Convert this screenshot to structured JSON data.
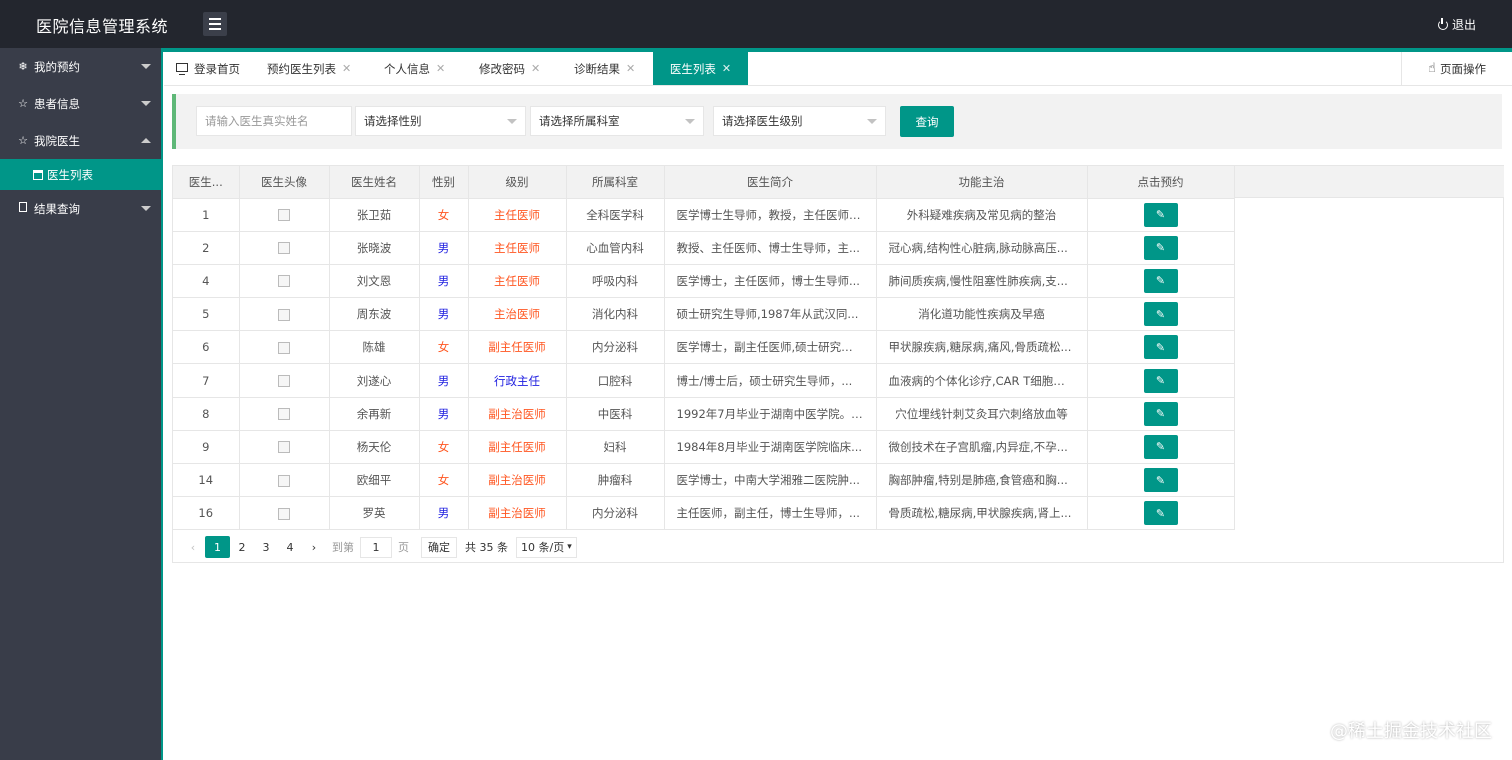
{
  "header": {
    "title": "医院信息管理系统",
    "logout_label": "退出"
  },
  "sidebar": {
    "items": [
      {
        "label": "我的预约",
        "icon": "snowflake-icon",
        "expanded": false
      },
      {
        "label": "患者信息",
        "icon": "star-icon",
        "expanded": false
      },
      {
        "label": "我院医生",
        "icon": "star-icon",
        "expanded": true
      },
      {
        "label": "结果查询",
        "icon": "document-icon",
        "expanded": false
      }
    ],
    "sub_item": {
      "label": "医生列表",
      "icon": "calendar-icon"
    }
  },
  "tabs": [
    {
      "label": "登录首页",
      "closable": false
    },
    {
      "label": "预约医生列表",
      "closable": true
    },
    {
      "label": "个人信息",
      "closable": true
    },
    {
      "label": "修改密码",
      "closable": true
    },
    {
      "label": "诊断结果",
      "closable": true
    },
    {
      "label": "医生列表",
      "closable": true,
      "active": true
    }
  ],
  "tab_close": "✕",
  "page_ops_label": "页面操作",
  "search": {
    "name_placeholder": "请输入医生真实姓名",
    "gender_select": "请选择性别",
    "dept_select": "请选择所属科室",
    "level_select": "请选择医生级别",
    "query_label": "查询"
  },
  "table": {
    "headers": [
      "医生...",
      "医生头像",
      "医生姓名",
      "性别",
      "级别",
      "所属科室",
      "医生简介",
      "功能主治",
      "点击预约"
    ],
    "rows": [
      {
        "id": "1",
        "name": "张卫茹",
        "gender": "女",
        "level": "主任医师",
        "dept": "全科医学科",
        "intro": "医学博士生导师，教授，主任医师,...",
        "specialty": "外科疑难疾病及常见病的整治"
      },
      {
        "id": "2",
        "name": "张晓波",
        "gender": "男",
        "level": "主任医师",
        "dept": "心血管内科",
        "intro": "教授、主任医师、博士生导师，主...",
        "specialty": "冠心病,结构性心脏病,脉动脉高压..."
      },
      {
        "id": "4",
        "name": "刘文恩",
        "gender": "男",
        "level": "主任医师",
        "dept": "呼吸内科",
        "intro": "医学博士，主任医师，博士生导师...",
        "specialty": "肺间质疾病,慢性阻塞性肺疾病,支..."
      },
      {
        "id": "5",
        "name": "周东波",
        "gender": "男",
        "level": "主治医师",
        "dept": "消化内科",
        "intro": "硕士研究生导师,1987年从武汉同...",
        "specialty": "消化道功能性疾病及早癌"
      },
      {
        "id": "6",
        "name": "陈雄",
        "gender": "女",
        "level": "副主任医师",
        "dept": "内分泌科",
        "intro": "医学博士，副主任医师,硕士研究生...",
        "specialty": "甲状腺疾病,糖尿病,痛风,骨质疏松..."
      },
      {
        "id": "7",
        "name": "刘遂心",
        "gender": "男",
        "level": "行政主任",
        "dept": "口腔科",
        "intro": "博士/博士后，硕士研究生导师，...",
        "specialty": "血液病的个体化诊疗,CAR T细胞免..."
      },
      {
        "id": "8",
        "name": "余再新",
        "gender": "男",
        "level": "副主治医师",
        "dept": "中医科",
        "intro": "1992年7月毕业于湖南中医学院。1...",
        "specialty": "穴位埋线针刺艾灸耳穴刺络放血等"
      },
      {
        "id": "9",
        "name": "杨天伦",
        "gender": "女",
        "level": "副主任医师",
        "dept": "妇科",
        "intro": "1984年8月毕业于湖南医学院临床...",
        "specialty": "微创技术在子宫肌瘤,内异症,不孕..."
      },
      {
        "id": "14",
        "name": "欧细平",
        "gender": "女",
        "level": "副主治医师",
        "dept": "肿瘤科",
        "intro": "医学博士，中南大学湘雅二医院肿...",
        "specialty": "胸部肿瘤,特别是肺癌,食管癌和胸..."
      },
      {
        "id": "16",
        "name": "罗英",
        "gender": "男",
        "level": "副主治医师",
        "dept": "内分泌科",
        "intro": "主任医师，副主任，博士生导师，...",
        "specialty": "骨质疏松,糖尿病,甲状腺疾病,肾上..."
      }
    ]
  },
  "pagination": {
    "pages": [
      "1",
      "2",
      "3",
      "4"
    ],
    "current": "1",
    "goto_prefix": "到第",
    "goto_value": "1",
    "goto_suffix": "页",
    "confirm_label": "确定",
    "total_label": "共 35 条",
    "limit_label": "10 条/页"
  },
  "watermark": "@稀土掘金技术社区",
  "colors": {
    "accent": "#009688",
    "header_bg": "#23262e",
    "sidebar_bg": "#393d49",
    "female": "#ff5722",
    "male": "#1e1ee0"
  }
}
